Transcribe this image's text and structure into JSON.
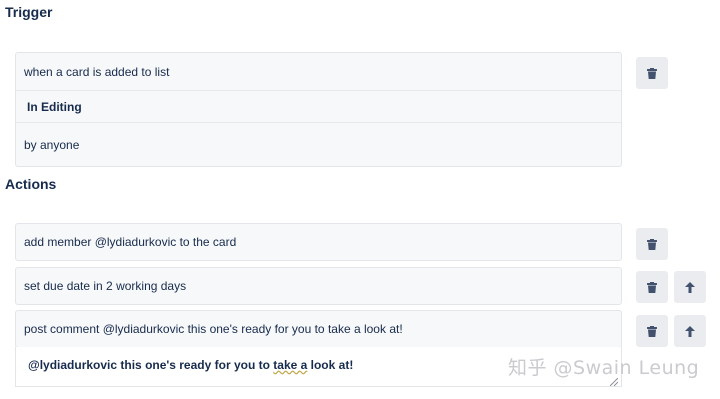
{
  "trigger": {
    "title": "Trigger",
    "line1": "when a card is added to list",
    "list_name": "In Editing",
    "line3": "by anyone"
  },
  "actions": {
    "title": "Actions",
    "items": [
      {
        "text": "add member @lydiadurkovic to the card"
      },
      {
        "text": "set due date in 2 working days"
      },
      {
        "text": "post comment @lydiadurkovic this one's ready for you to take a look at!"
      }
    ],
    "comment": {
      "mention": "@lydiadurkovic",
      "before": " this one's ready for you to ",
      "highlight": "take a",
      "after": " look at!"
    }
  },
  "watermark": "知乎 @Swain Leung",
  "icons": {
    "delete": "trash-icon",
    "move_up": "arrow-up-icon"
  },
  "colors": {
    "card_bg": "#f7f8f9",
    "button_bg": "#ebecf0",
    "text": "#172b4d"
  }
}
